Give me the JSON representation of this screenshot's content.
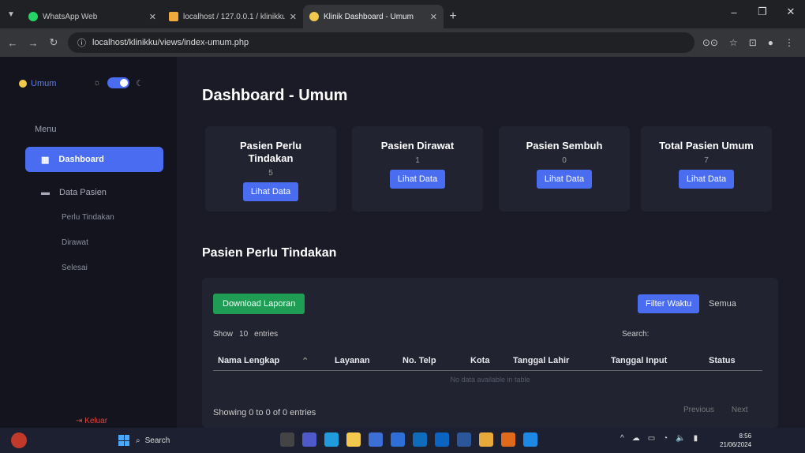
{
  "browser": {
    "tabs": [
      {
        "title": "WhatsApp Web",
        "color": "#25d366"
      },
      {
        "title": "localhost / 127.0.0.1 / klinikku |",
        "color": "#f2a93b"
      },
      {
        "title": "Klinik Dashboard - Umum",
        "color": "#f2c94c"
      }
    ],
    "url": "localhost/klinikku/views/index-umum.php"
  },
  "sidebar": {
    "user": "Umum",
    "menu_label": "Menu",
    "dashboard": "Dashboard",
    "data_pasien": "Data Pasien",
    "sub_items": [
      "Perlu Tindakan",
      "Dirawat",
      "Selesai"
    ],
    "logout": "Keluar"
  },
  "main": {
    "title": "Dashboard - Umum",
    "cards": [
      {
        "title": "Pasien Perlu Tindakan",
        "value": "5",
        "button": "Lihat Data"
      },
      {
        "title": "Pasien Dirawat",
        "value": "1",
        "button": "Lihat Data"
      },
      {
        "title": "Pasien Sembuh",
        "value": "0",
        "button": "Lihat Data"
      },
      {
        "title": "Total Pasien Umum",
        "value": "7",
        "button": "Lihat Data"
      }
    ],
    "section_title": "Pasien Perlu Tindakan",
    "download_button": "Download Laporan",
    "filter_button": "Filter Waktu",
    "semua_button": "Semua",
    "show_label": "Show",
    "show_value": "10",
    "entries_label": "entries",
    "search_label": "Search:",
    "columns": [
      "Nama Lengkap",
      "Layanan",
      "No. Telp",
      "Kota",
      "Tanggal Lahir",
      "Tanggal Input",
      "Status"
    ],
    "no_data": "No data available in table",
    "showing": "Showing 0 to 0 of 0 entries",
    "previous": "Previous",
    "next": "Next"
  },
  "taskbar": {
    "search": "Search",
    "time": "8:56",
    "date": "21/06/2024"
  }
}
